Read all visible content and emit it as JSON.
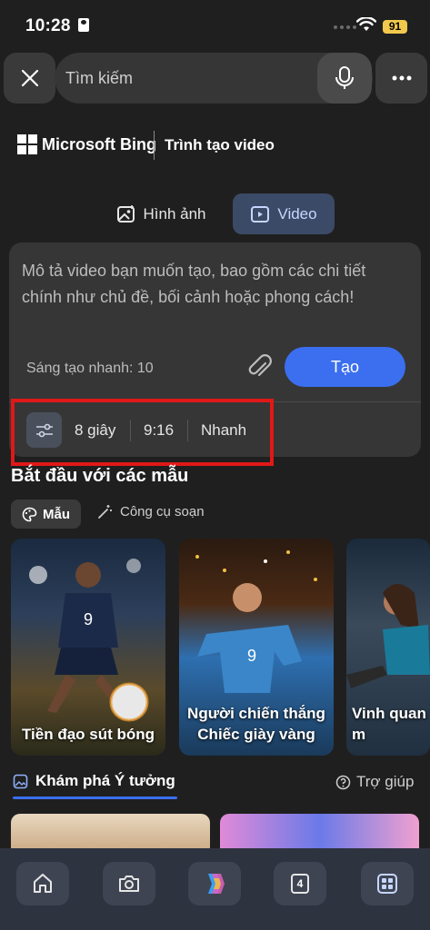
{
  "status_bar": {
    "time": "10:28",
    "battery": "91",
    "battery_color": "#f2c94c"
  },
  "search": {
    "placeholder": "Tìm kiếm"
  },
  "header": {
    "brand": "Microsoft Bing",
    "subtitle": "Trình tạo video"
  },
  "mode_tabs": [
    {
      "label": "Hình ảnh",
      "icon": "image-icon",
      "selected": false
    },
    {
      "label": "Video",
      "icon": "video-icon",
      "selected": true
    }
  ],
  "prompt": {
    "placeholder": "Mô tả video bạn muốn tạo, bao gồm các chi tiết chính như chủ đề, bối cảnh hoặc phong cách!",
    "quick_create": "Sáng tạo nhanh: 10",
    "create_label": "Tạo"
  },
  "options": {
    "duration": "8 giây",
    "aspect_ratio": "9:16",
    "speed": "Nhanh"
  },
  "templates": {
    "title": "Bắt đầu với các mẫu",
    "chips": [
      {
        "label": "Mẫu",
        "selected": true
      },
      {
        "label": "Công cụ soạn",
        "selected": false
      }
    ],
    "cards": [
      {
        "label": "Tiền đạo sút bóng"
      },
      {
        "label": "Người chiến thắng Chiếc giày vàng"
      },
      {
        "label": "Vinh quan m"
      }
    ]
  },
  "explore": {
    "label": "Khám phá Ý tưởng",
    "help": "Trợ giúp"
  },
  "bottom_nav": {
    "tab_count": "4"
  },
  "colors": {
    "accent": "#3b6ff0",
    "highlight": "#e01818",
    "background": "#1f1f1f"
  }
}
